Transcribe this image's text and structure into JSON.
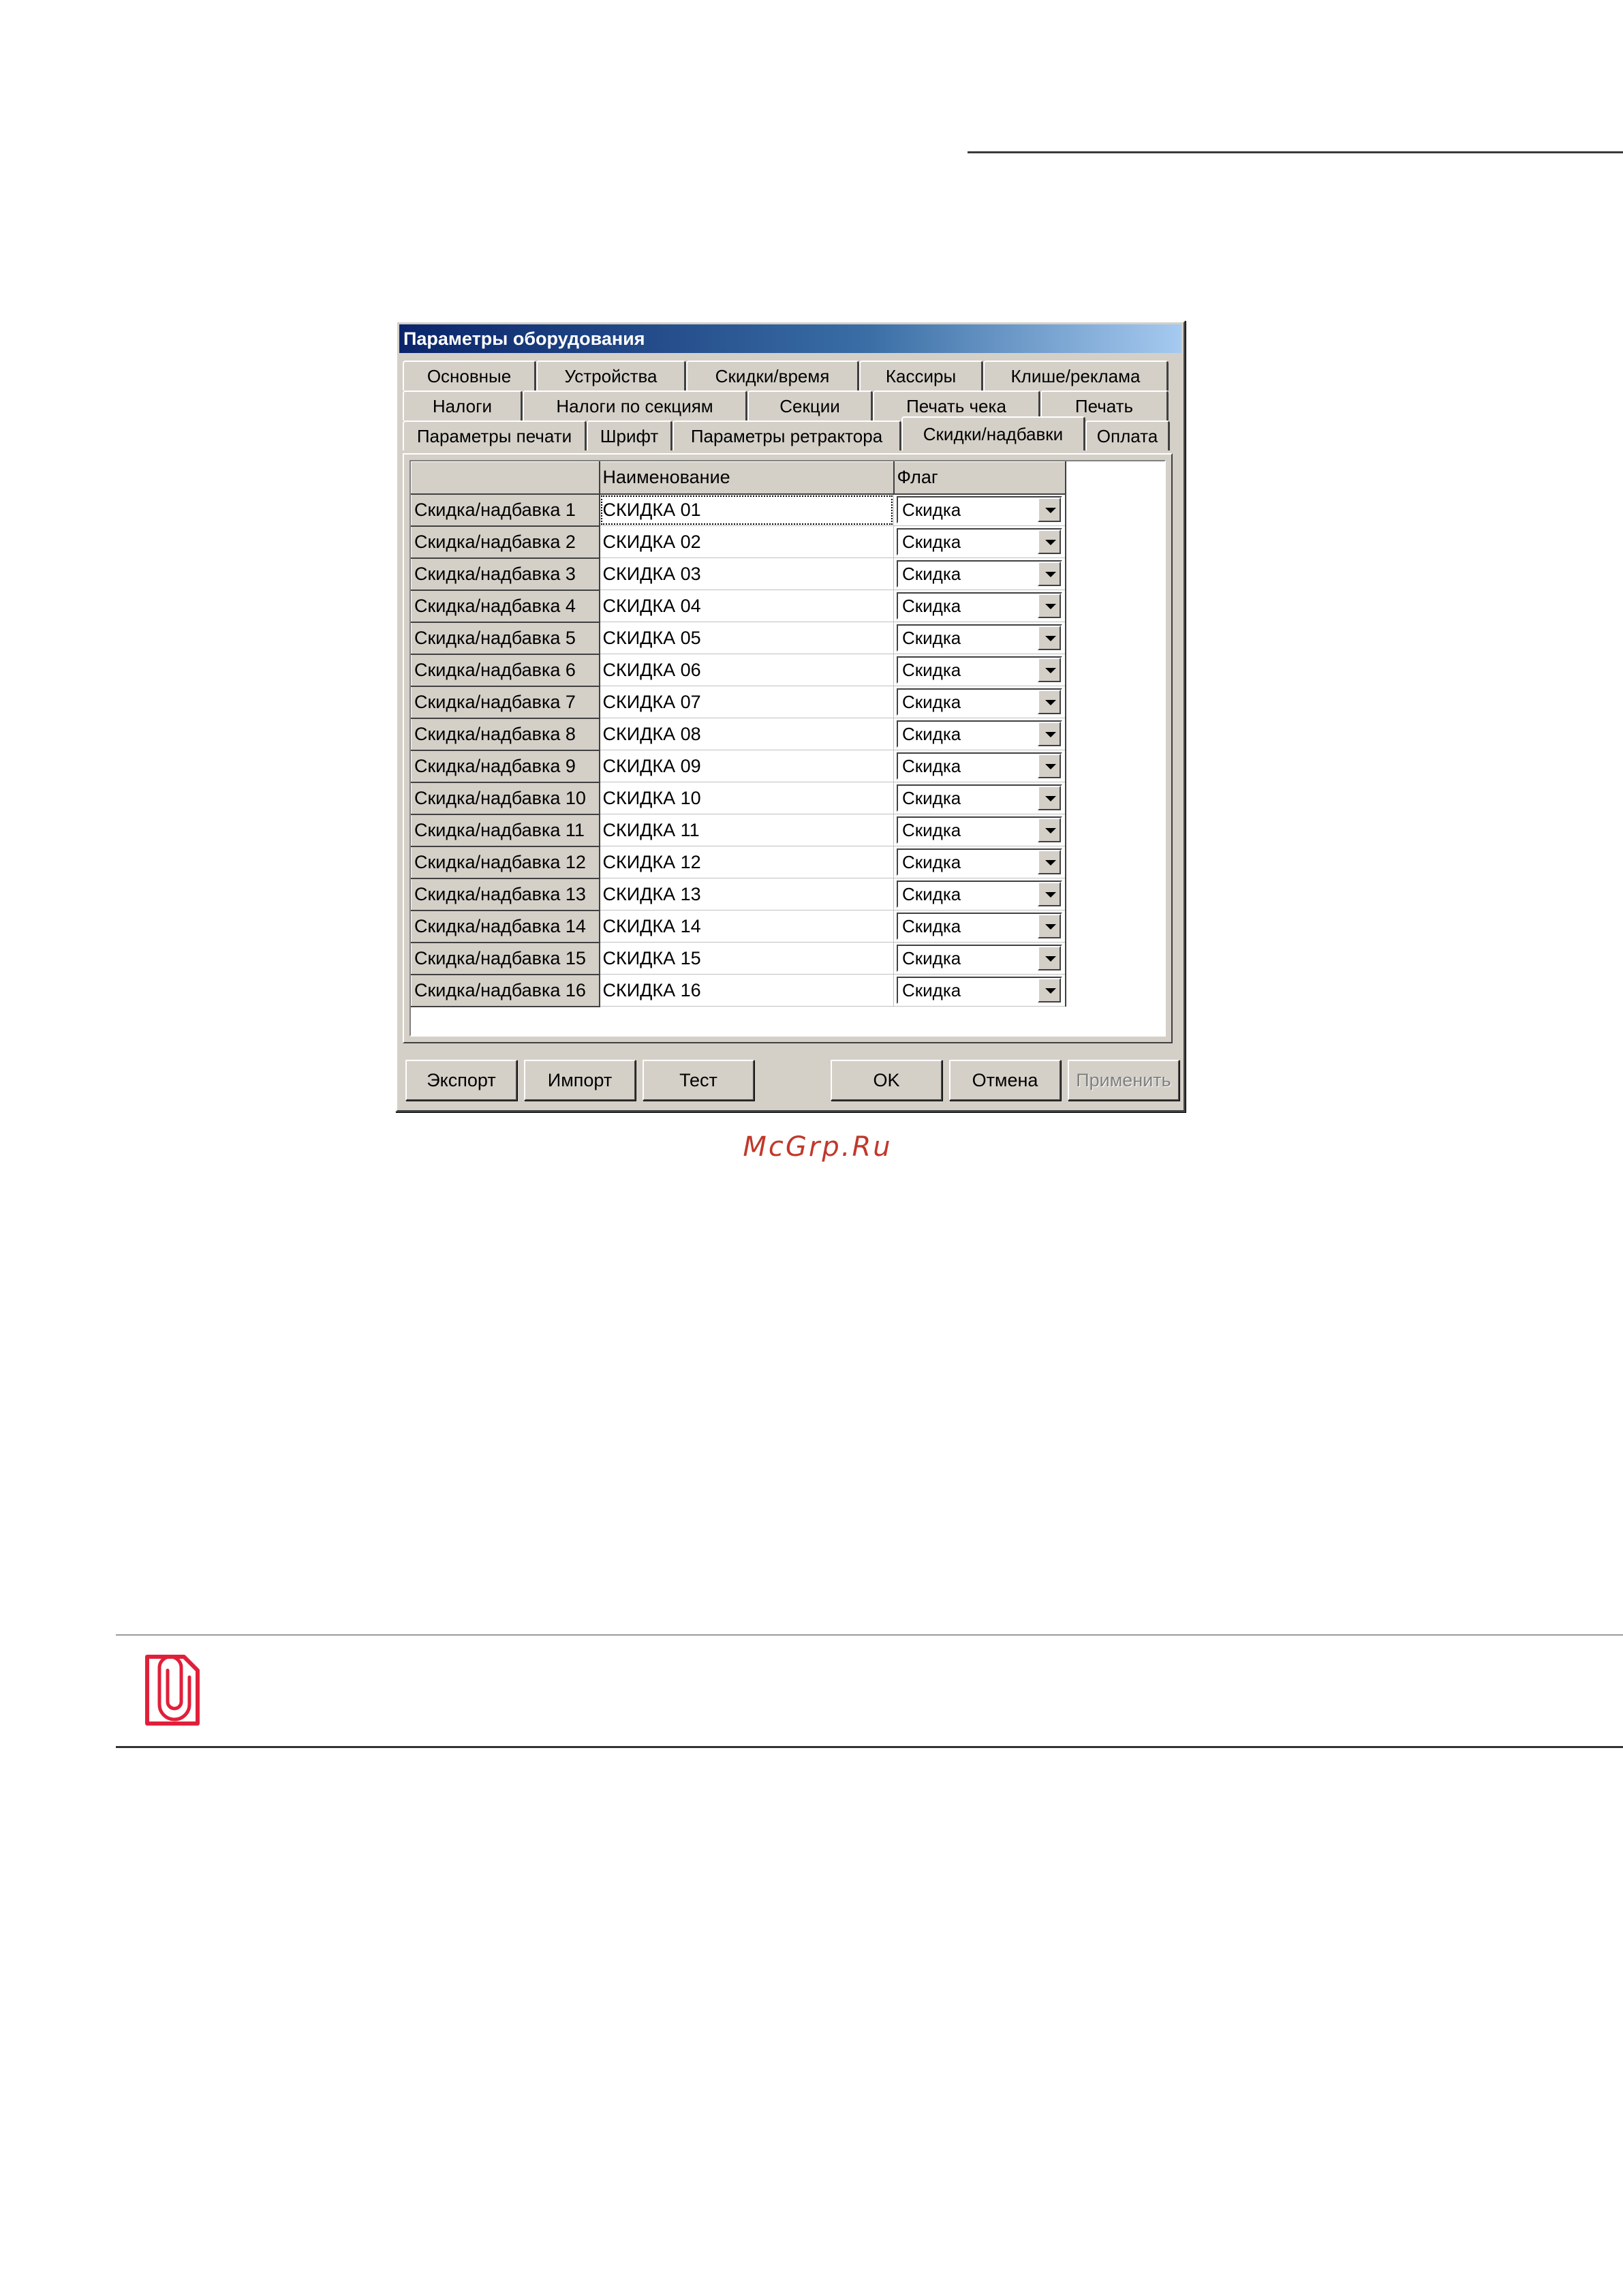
{
  "window": {
    "title": "Параметры оборудования"
  },
  "tabs": {
    "row1": [
      "Основные",
      "Устройства",
      "Скидки/время",
      "Кассиры",
      "Клише/реклама"
    ],
    "row2": [
      "Налоги",
      "Налоги по секциям",
      "Секции",
      "Печать чека",
      "Печать"
    ],
    "row3": [
      "Параметры печати",
      "Шрифт",
      "Параметры ретрактора",
      "Скидки/надбавки",
      "Оплата"
    ],
    "active": "Скидки/надбавки"
  },
  "grid": {
    "columns": [
      "",
      "Наименование",
      "Флаг"
    ],
    "rows": [
      {
        "label": "Скидка/надбавка 1",
        "name": "СКИДКА 01",
        "flag": "Скидка"
      },
      {
        "label": "Скидка/надбавка 2",
        "name": "СКИДКА 02",
        "flag": "Скидка"
      },
      {
        "label": "Скидка/надбавка 3",
        "name": "СКИДКА 03",
        "flag": "Скидка"
      },
      {
        "label": "Скидка/надбавка 4",
        "name": "СКИДКА 04",
        "flag": "Скидка"
      },
      {
        "label": "Скидка/надбавка 5",
        "name": "СКИДКА 05",
        "flag": "Скидка"
      },
      {
        "label": "Скидка/надбавка 6",
        "name": "СКИДКА 06",
        "flag": "Скидка"
      },
      {
        "label": "Скидка/надбавка 7",
        "name": "СКИДКА 07",
        "flag": "Скидка"
      },
      {
        "label": "Скидка/надбавка 8",
        "name": "СКИДКА 08",
        "flag": "Скидка"
      },
      {
        "label": "Скидка/надбавка 9",
        "name": "СКИДКА 09",
        "flag": "Скидка"
      },
      {
        "label": "Скидка/надбавка 10",
        "name": "СКИДКА 10",
        "flag": "Скидка"
      },
      {
        "label": "Скидка/надбавка 11",
        "name": "СКИДКА 11",
        "flag": "Скидка"
      },
      {
        "label": "Скидка/надбавка 12",
        "name": "СКИДКА 12",
        "flag": "Скидка"
      },
      {
        "label": "Скидка/надбавка 13",
        "name": "СКИДКА 13",
        "flag": "Скидка"
      },
      {
        "label": "Скидка/надбавка 14",
        "name": "СКИДКА 14",
        "flag": "Скидка"
      },
      {
        "label": "Скидка/надбавка 15",
        "name": "СКИДКА 15",
        "flag": "Скидка"
      },
      {
        "label": "Скидка/надбавка 16",
        "name": "СКИДКА 16",
        "flag": "Скидка"
      }
    ]
  },
  "buttons": {
    "export": "Экспорт",
    "import": "Импорт",
    "test": "Тест",
    "ok": "OK",
    "cancel": "Отмена",
    "apply": "Применить"
  },
  "watermark": "McGrp.Ru",
  "note_icon": "paperclip-document-icon",
  "colors": {
    "title_start": "#0a246a",
    "title_end": "#a6caf0",
    "face": "#d4d0c8",
    "note_icon": "#e0203a",
    "watermark": "#c0392b"
  }
}
